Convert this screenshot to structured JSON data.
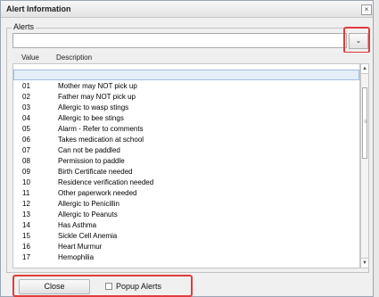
{
  "dialog": {
    "title": "Alert Information",
    "close_glyph": "×"
  },
  "alerts_group": {
    "legend": "Alerts",
    "select_value": "",
    "dropdown_glyph": "⌄"
  },
  "table": {
    "columns": [
      "Value",
      "Description"
    ],
    "rows": [
      {
        "value": "",
        "description": "",
        "selected": true
      },
      {
        "value": "01",
        "description": "Mother may NOT pick up"
      },
      {
        "value": "02",
        "description": "Father may NOT pick up"
      },
      {
        "value": "03",
        "description": "Allergic to wasp stings"
      },
      {
        "value": "04",
        "description": "Allergic to bee stings"
      },
      {
        "value": "05",
        "description": "Alarm - Refer to comments"
      },
      {
        "value": "06",
        "description": "Takes medication at school"
      },
      {
        "value": "07",
        "description": "Can not be paddled"
      },
      {
        "value": "08",
        "description": "Permission to paddle"
      },
      {
        "value": "09",
        "description": "Birth Certificate needed"
      },
      {
        "value": "10",
        "description": "Residence verification needed"
      },
      {
        "value": "11",
        "description": "Other paperwork needed"
      },
      {
        "value": "12",
        "description": "Allergic to Penicillin"
      },
      {
        "value": "13",
        "description": "Allergic to Peanuts"
      },
      {
        "value": "14",
        "description": "Has Asthma"
      },
      {
        "value": "15",
        "description": "Sickle Cell Anemia"
      },
      {
        "value": "16",
        "description": "Heart Murmur"
      },
      {
        "value": "17",
        "description": "Hemophilia"
      }
    ]
  },
  "scrollbar": {
    "up_glyph": "▲",
    "down_glyph": "▼",
    "grip_glyph": "≡"
  },
  "footer": {
    "close_label": "Close",
    "popup_label": "Popup Alerts",
    "popup_checked": false
  },
  "colors": {
    "highlight": "#e23b3b",
    "selected_row": "#e4eef9"
  }
}
